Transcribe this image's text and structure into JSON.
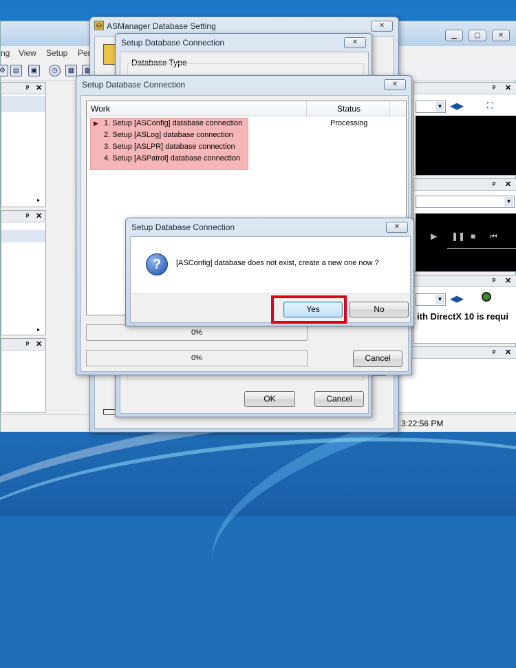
{
  "main_app": {
    "menu": [
      "ng",
      "View",
      "Setup",
      "Per"
    ],
    "status_time": "3:22:56 PM",
    "directx_text": "ith DirectX 10 is requi"
  },
  "win_settings": {
    "title": "ASManager Database Setting"
  },
  "win_setup_back": {
    "title": "Setup Database Connection",
    "database_type_label": "Database Type",
    "ok": "OK",
    "cancel": "Cancel"
  },
  "win_progress": {
    "title": "Setup Database Connection",
    "columns": [
      "Work",
      "Status"
    ],
    "tasks": [
      {
        "label": "1. Setup [ASConfig] database connection",
        "status": "Processing"
      },
      {
        "label": "2. Setup [ASLog] database connection",
        "status": ""
      },
      {
        "label": "3. Setup [ASLPR] database connection",
        "status": ""
      },
      {
        "label": "4. Setup [ASPatrol] database connection",
        "status": ""
      }
    ],
    "progress1": "0%",
    "progress2": "0%",
    "progress1_value": 0,
    "progress2_value": 0,
    "cancel": "Cancel"
  },
  "dialog": {
    "title": "Setup Database Connection",
    "message": "[ASConfig] database does not exist, create a new one now ?",
    "yes": "Yes",
    "no": "No",
    "icon": "question-icon"
  },
  "colors": {
    "highlight": "#e0001a",
    "task_highlight": "#f4b6b6"
  }
}
